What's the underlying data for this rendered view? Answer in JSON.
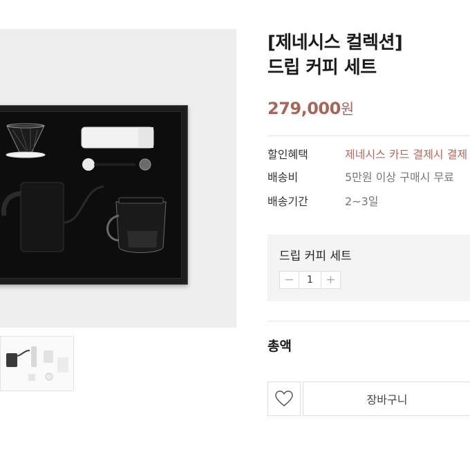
{
  "product": {
    "title_line1": "[제네시스 컬렉션]",
    "title_line2": "드립 커피 세트",
    "price_amount": "279,000",
    "price_unit": "원"
  },
  "info": [
    {
      "label": "할인혜택",
      "value": "제네시스 카드 결제시 결제"
    },
    {
      "label": "배송비",
      "value": "5만원 이상 구매시 무료"
    },
    {
      "label": "배송기간",
      "value": "2~3일"
    }
  ],
  "option": {
    "name": "드립 커피 세트",
    "quantity": "1",
    "minus": "−",
    "plus": "+"
  },
  "total_label": "총액",
  "actions": {
    "wishlist_icon": "heart-icon",
    "cart_label": "장바구니"
  },
  "colors": {
    "price": "#a8665a",
    "discount_text": "#b2685c",
    "image_bg": "#eeeeee",
    "option_bg": "#f4f4f4"
  }
}
